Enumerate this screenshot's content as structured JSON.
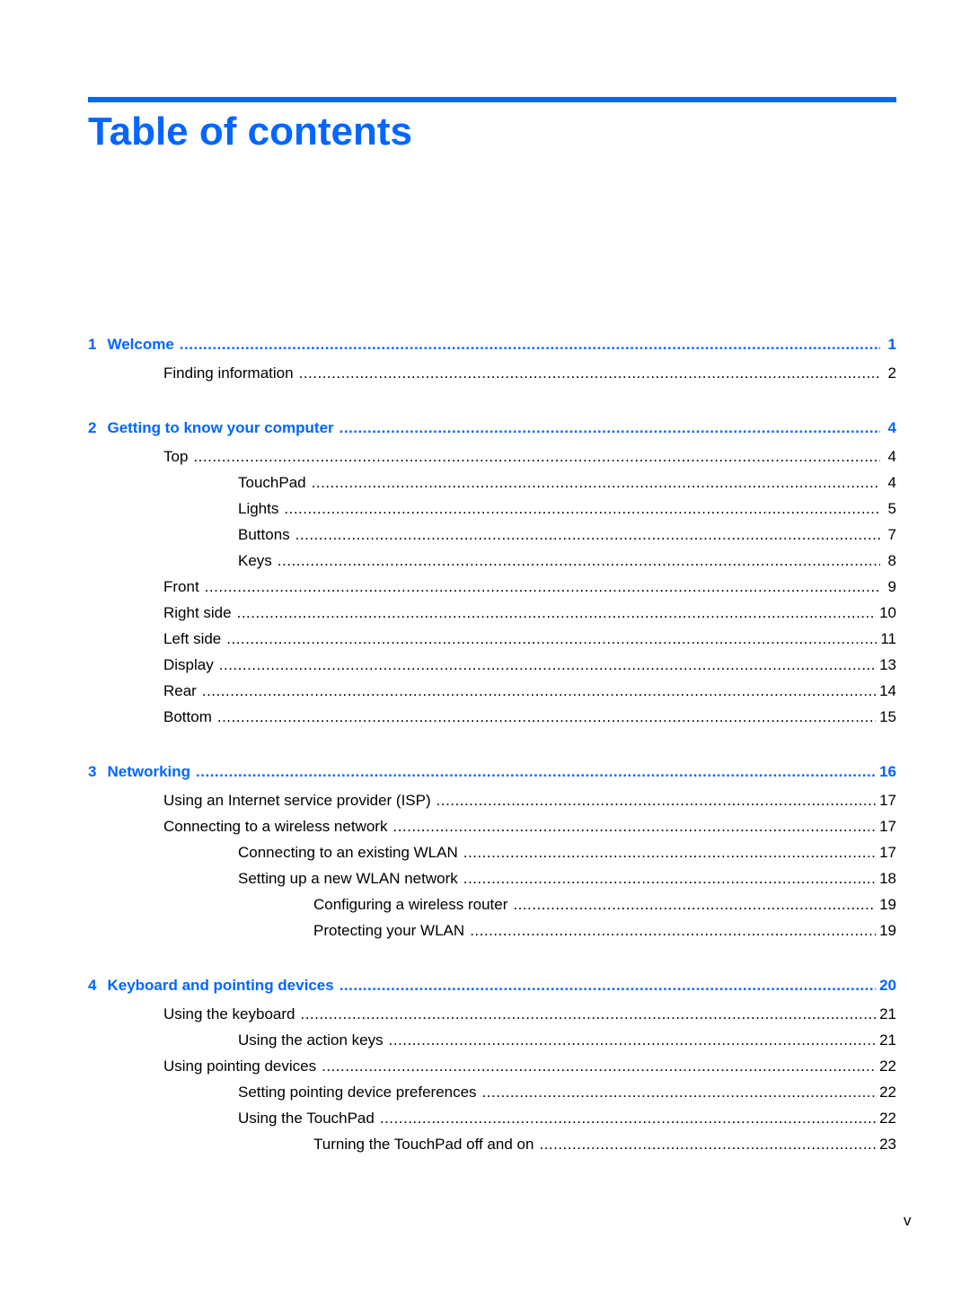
{
  "document": {
    "title": "Table of contents",
    "accent_color": "#0066ff",
    "folio": "v"
  },
  "chapters": [
    {
      "number": "1",
      "title": "Welcome",
      "page": "1",
      "entries": [
        {
          "level": 1,
          "label": "Finding information",
          "page": "2"
        }
      ]
    },
    {
      "number": "2",
      "title": "Getting to know your computer",
      "page": "4",
      "entries": [
        {
          "level": 1,
          "label": "Top",
          "page": "4"
        },
        {
          "level": 2,
          "label": "TouchPad",
          "page": "4"
        },
        {
          "level": 2,
          "label": "Lights",
          "page": "5"
        },
        {
          "level": 2,
          "label": "Buttons",
          "page": "7"
        },
        {
          "level": 2,
          "label": "Keys",
          "page": "8"
        },
        {
          "level": 1,
          "label": "Front",
          "page": "9"
        },
        {
          "level": 1,
          "label": "Right side",
          "page": "10"
        },
        {
          "level": 1,
          "label": "Left side",
          "page": "11"
        },
        {
          "level": 1,
          "label": "Display",
          "page": "13"
        },
        {
          "level": 1,
          "label": "Rear",
          "page": "14"
        },
        {
          "level": 1,
          "label": "Bottom",
          "page": "15"
        }
      ]
    },
    {
      "number": "3",
      "title": "Networking",
      "page": "16",
      "entries": [
        {
          "level": 1,
          "label": "Using an Internet service provider (ISP)",
          "page": "17"
        },
        {
          "level": 1,
          "label": "Connecting to a wireless network",
          "page": "17"
        },
        {
          "level": 2,
          "label": "Connecting to an existing WLAN",
          "page": "17"
        },
        {
          "level": 2,
          "label": "Setting up a new WLAN network",
          "page": "18"
        },
        {
          "level": 3,
          "label": "Configuring a wireless router",
          "page": "19"
        },
        {
          "level": 3,
          "label": "Protecting your WLAN",
          "page": "19"
        }
      ]
    },
    {
      "number": "4",
      "title": "Keyboard and pointing devices",
      "page": "20",
      "entries": [
        {
          "level": 1,
          "label": "Using the keyboard",
          "page": "21"
        },
        {
          "level": 2,
          "label": "Using the action keys",
          "page": "21"
        },
        {
          "level": 1,
          "label": "Using pointing devices",
          "page": "22"
        },
        {
          "level": 2,
          "label": "Setting pointing device preferences",
          "page": "22"
        },
        {
          "level": 2,
          "label": "Using the TouchPad",
          "page": "22"
        },
        {
          "level": 3,
          "label": "Turning the TouchPad off and on",
          "page": "23"
        }
      ]
    }
  ]
}
